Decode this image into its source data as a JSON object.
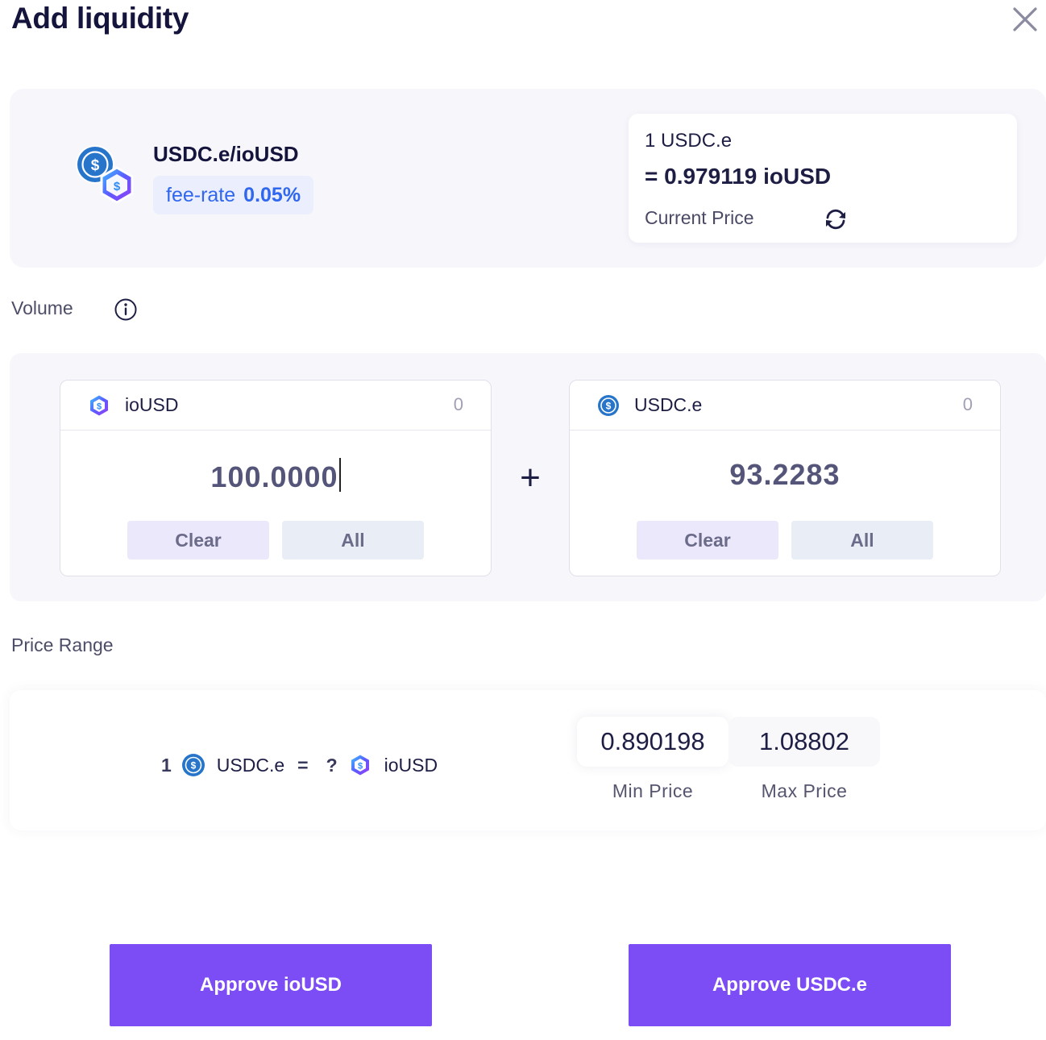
{
  "header": {
    "title": "Add liquidity"
  },
  "pair": {
    "name": "USDC.e/ioUSD",
    "fee_label": "fee-rate",
    "fee_value": "0.05%"
  },
  "current_price": {
    "base": "1 USDC.e",
    "quote": "= 0.979119 ioUSD",
    "label": "Current Price"
  },
  "volume": {
    "label": "Volume",
    "tokens": [
      {
        "symbol": "ioUSD",
        "balance": "0",
        "amount": "100.0000",
        "clear_label": "Clear",
        "all_label": "All",
        "icon": "iousd-icon"
      },
      {
        "symbol": "USDC.e",
        "balance": "0",
        "amount": "93.2283",
        "clear_label": "Clear",
        "all_label": "All",
        "icon": "usdc-icon"
      }
    ],
    "plus": "+"
  },
  "price_range": {
    "label": "Price Range",
    "eq_amount": "1",
    "eq_base": "USDC.e",
    "eq_sign": "=",
    "eq_unknown": "?",
    "eq_quote": "ioUSD",
    "min_price": "0.890198",
    "min_label": "Min Price",
    "max_price": "1.08802",
    "max_label": "Max Price"
  },
  "actions": {
    "approve_iousd": "Approve ioUSD",
    "approve_usdc": "Approve USDC.e"
  },
  "colors": {
    "primary": "#7c4cf5",
    "fee_blue": "#2f67ee",
    "usdc_blue": "#2775ca",
    "iousd_purple": "#6a3cf0"
  }
}
